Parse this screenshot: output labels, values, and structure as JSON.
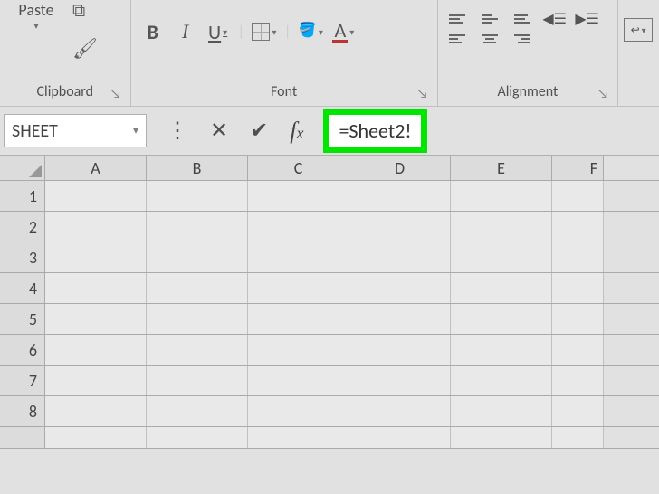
{
  "ribbon": {
    "clipboard": {
      "paste_label": "Paste",
      "section_label": "Clipboard"
    },
    "font": {
      "bold": "B",
      "italic": "I",
      "underline": "U",
      "font_color_letter": "A",
      "section_label": "Font"
    },
    "alignment": {
      "section_label": "Alignment"
    }
  },
  "name_box": {
    "value": "SHEET"
  },
  "formula_bar": {
    "value": "=Sheet2!"
  },
  "columns": [
    "A",
    "B",
    "C",
    "D",
    "E",
    "F"
  ],
  "rows": [
    "1",
    "2",
    "3",
    "4",
    "5",
    "6",
    "7",
    "8"
  ]
}
